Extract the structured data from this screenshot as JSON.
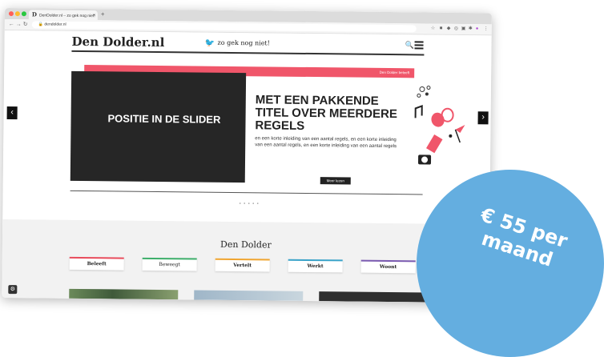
{
  "browser": {
    "tab_favicon": "D",
    "tab_title": "DenDolder.nl – zo gek nog niet!",
    "tab_close": "×",
    "new_tab": "+",
    "url": "dendolder.nl",
    "colors": {
      "close": "#ff5f57",
      "minimize": "#febc2e",
      "maximize": "#28c840"
    }
  },
  "header": {
    "logo": "Den Dolder.nl",
    "tagline": "zo gek nog niet!"
  },
  "slider": {
    "badge": "Den Dolder beleeft",
    "placeholder_text": "POSITIE IN DE SLIDER",
    "title": "MET EEN PAKKENDE TITEL OVER MEERDERE REGELS",
    "intro": "en een korte inleiding van een aantal regels, en een korte inleiding van een aantal regels, en een korte inleiding van een aantal regels",
    "button": "Meer lezen",
    "prev": "‹",
    "next": "›",
    "dots": "● ● ● ● ●",
    "accent": "#f0566a"
  },
  "section": {
    "title": "Den Dolder",
    "categories": [
      {
        "label": "Beleeft",
        "color": "#e84c5c"
      },
      {
        "label": "Beweegt",
        "color": "#3dae6a"
      },
      {
        "label": "Vertelt",
        "color": "#f0a530"
      },
      {
        "label": "Werkt",
        "color": "#3aa3c9"
      },
      {
        "label": "Woont",
        "color": "#7a5ab0"
      }
    ]
  },
  "promo": {
    "price": "€ 55 per maand",
    "color": "#64aee0"
  }
}
